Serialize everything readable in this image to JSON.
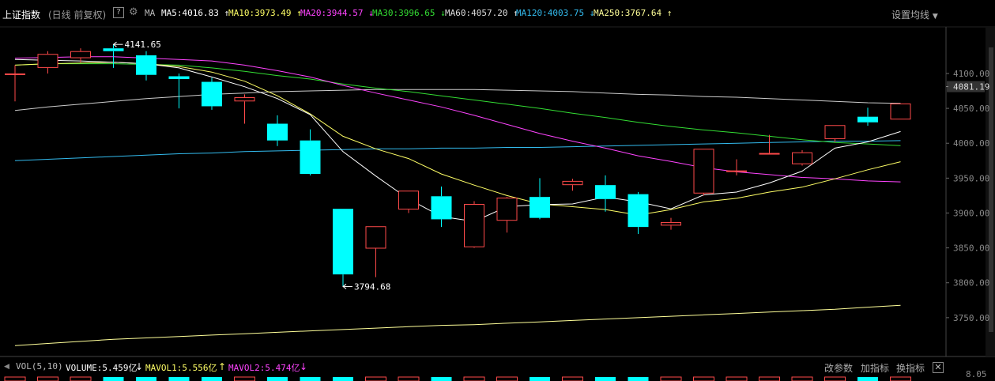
{
  "header": {
    "title": "上证指数",
    "subtitle": "(日线 前复权)",
    "help": "?",
    "ma_label": "MA",
    "ma_items": [
      {
        "text": "MA5:4016.83",
        "arrow": "↑",
        "color": "#ffffff"
      },
      {
        "text": "MA10:3973.49",
        "arrow": "↑",
        "color": "#ffff66"
      },
      {
        "text": "MA20:3944.57",
        "arrow": "↓",
        "color": "#ff44ff"
      },
      {
        "text": "MA30:3996.65",
        "arrow": "↓",
        "color": "#33dd33"
      },
      {
        "text": "MA60:4057.20",
        "arrow": "↑",
        "color": "#dddddd"
      },
      {
        "text": "MA120:4003.75",
        "arrow": "↓",
        "color": "#33bbee"
      },
      {
        "text": "MA250:3767.64",
        "arrow": "↑",
        "color": "#ffff99"
      }
    ],
    "settings": "设置均线"
  },
  "price_axis": {
    "ticks": [
      "4100.00",
      "4081.19",
      "4050.00",
      "4000.00",
      "3950.00",
      "3900.00",
      "3850.00",
      "3800.00",
      "3750.00"
    ],
    "current": "4081.19"
  },
  "annotations": {
    "high": "4141.65",
    "low": "3794.68"
  },
  "volume_bar": {
    "label": "VOL(5,10)",
    "volume": "VOLUME:5.459亿",
    "volume_arrow": "↓",
    "mavol1": "MAVOL1:5.556亿",
    "mavol1_arrow": "↑",
    "mavol2": "MAVOL2:5.474亿",
    "mavol2_arrow": "↓",
    "btn_params": "改参数",
    "btn_add": "加指标",
    "btn_switch": "换指标",
    "close": "✕",
    "axis_value": "8.05"
  },
  "colors": {
    "up": "#ff4a4a",
    "down": "#00ffff"
  },
  "chart_data": {
    "type": "candlestick",
    "ylim": [
      3700,
      4160
    ],
    "candles": [
      {
        "o": 4100,
        "c": 4100,
        "h": 4112,
        "l": 4060
      },
      {
        "o": 4108,
        "c": 4128,
        "h": 4132,
        "l": 4100
      },
      {
        "o": 4122,
        "c": 4132,
        "h": 4136,
        "l": 4116
      },
      {
        "o": 4136,
        "c": 4132,
        "h": 4141.65,
        "l": 4108
      },
      {
        "o": 4126,
        "c": 4098,
        "h": 4132,
        "l": 4090
      },
      {
        "o": 4096,
        "c": 4092,
        "h": 4100,
        "l": 4050
      },
      {
        "o": 4088,
        "c": 4053,
        "h": 4094,
        "l": 4048
      },
      {
        "o": 4060,
        "c": 4066,
        "h": 4070,
        "l": 4028
      },
      {
        "o": 4028,
        "c": 4004,
        "h": 4040,
        "l": 3996
      },
      {
        "o": 4004,
        "c": 3956,
        "h": 4020,
        "l": 3954
      },
      {
        "o": 3906,
        "c": 3812,
        "h": 3906,
        "l": 3794.68
      },
      {
        "o": 3849,
        "c": 3881,
        "h": 3881,
        "l": 3808
      },
      {
        "o": 3905,
        "c": 3932,
        "h": 3932,
        "l": 3900
      },
      {
        "o": 3924,
        "c": 3891,
        "h": 3938,
        "l": 3880
      },
      {
        "o": 3851,
        "c": 3913,
        "h": 3917,
        "l": 3850
      },
      {
        "o": 3889,
        "c": 3922,
        "h": 3923,
        "l": 3872
      },
      {
        "o": 3923,
        "c": 3893,
        "h": 3950,
        "l": 3891
      },
      {
        "o": 3940,
        "c": 3946,
        "h": 3949,
        "l": 3932
      },
      {
        "o": 3940,
        "c": 3920,
        "h": 3954,
        "l": 3902
      },
      {
        "o": 3927,
        "c": 3880,
        "h": 3930,
        "l": 3870
      },
      {
        "o": 3882,
        "c": 3887,
        "h": 3893,
        "l": 3876
      },
      {
        "o": 3928,
        "c": 3992,
        "h": 3992,
        "l": 3925
      },
      {
        "o": 3961,
        "c": 3961,
        "h": 3977,
        "l": 3954
      },
      {
        "o": 3984,
        "c": 3986,
        "h": 4012,
        "l": 3984
      },
      {
        "o": 3970,
        "c": 3987,
        "h": 3990,
        "l": 3968
      },
      {
        "o": 4006,
        "c": 4026,
        "h": 4026,
        "l": 4002
      },
      {
        "o": 4038,
        "c": 4030,
        "h": 4051,
        "l": 4025
      },
      {
        "o": 4034,
        "c": 4057,
        "h": 4057,
        "l": 4034
      }
    ],
    "ma5": [
      4120,
      4119,
      4118,
      4116,
      4114,
      4108,
      4095,
      4081,
      4064,
      4041,
      3988,
      3953,
      3920,
      3895,
      3888,
      3909,
      3912,
      3913,
      3923,
      3916,
      3906,
      3926,
      3930,
      3943,
      3960,
      3993,
      4002,
      4016.83
    ],
    "ma10": [
      4112,
      4114,
      4115,
      4116,
      4114,
      4110,
      4102,
      4089,
      4068,
      4042,
      4010,
      3992,
      3978,
      3956,
      3940,
      3925,
      3913,
      3909,
      3905,
      3897,
      3905,
      3916,
      3921,
      3930,
      3937,
      3949,
      3962,
      3973.49
    ],
    "ma20": [
      4122,
      4123,
      4124,
      4124,
      4122,
      4120,
      4118,
      4112,
      4104,
      4095,
      4083,
      4072,
      4062,
      4052,
      4040,
      4027,
      4014,
      4003,
      3993,
      3982,
      3974,
      3965,
      3959,
      3955,
      3951,
      3949,
      3946,
      3944.57
    ],
    "ma30": [
      4112,
      4114,
      4114,
      4114,
      4113,
      4112,
      4108,
      4103,
      4097,
      4092,
      4085,
      4079,
      4074,
      4068,
      4062,
      4056,
      4050,
      4043,
      4037,
      4030,
      4024,
      4019,
      4015,
      4010,
      4005,
      4001,
      3999,
      3996.65
    ],
    "ma60": [
      4047,
      4052,
      4056,
      4060,
      4064,
      4067,
      4070,
      4072,
      4074,
      4075,
      4076,
      4077,
      4077,
      4077,
      4077,
      4076,
      4075,
      4074,
      4072,
      4070,
      4069,
      4067,
      4066,
      4064,
      4062,
      4060,
      4058,
      4057.2
    ],
    "ma120": [
      3975,
      3977,
      3979,
      3981,
      3983,
      3985,
      3986,
      3988,
      3989,
      3990,
      3991,
      3992,
      3992,
      3993,
      3993,
      3994,
      3994,
      3995,
      3996,
      3997,
      3998,
      3999,
      4000,
      4001,
      4002,
      4003,
      4003,
      4003.75
    ],
    "ma250": [
      3710,
      3713,
      3716,
      3719,
      3721,
      3723,
      3725,
      3727,
      3729,
      3731,
      3733,
      3735,
      3737,
      3739,
      3740,
      3742,
      3744,
      3746,
      3748,
      3750,
      3752,
      3754,
      3756,
      3758,
      3760,
      3762,
      3765,
      3767.64
    ]
  }
}
